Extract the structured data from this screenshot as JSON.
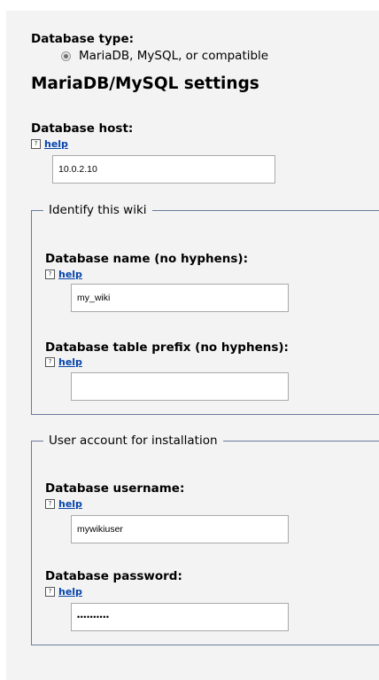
{
  "db_type": {
    "label": "Database type:",
    "option": "MariaDB, MySQL, or compatible"
  },
  "settings_heading": "MariaDB/MySQL settings",
  "host": {
    "label": "Database host:",
    "help": "help",
    "value": "10.0.2.10"
  },
  "identify": {
    "legend": "Identify this wiki",
    "name_label": "Database name (no hyphens):",
    "name_help": "help",
    "name_value": "my_wiki",
    "prefix_label": "Database table prefix (no hyphens):",
    "prefix_help": "help",
    "prefix_value": ""
  },
  "account": {
    "legend": "User account for installation",
    "username_label": "Database username:",
    "username_help": "help",
    "username_value": "mywikiuser",
    "password_label": "Database password:",
    "password_help": "help",
    "password_value": "••••••••••"
  },
  "help_icon_glyph": "?"
}
